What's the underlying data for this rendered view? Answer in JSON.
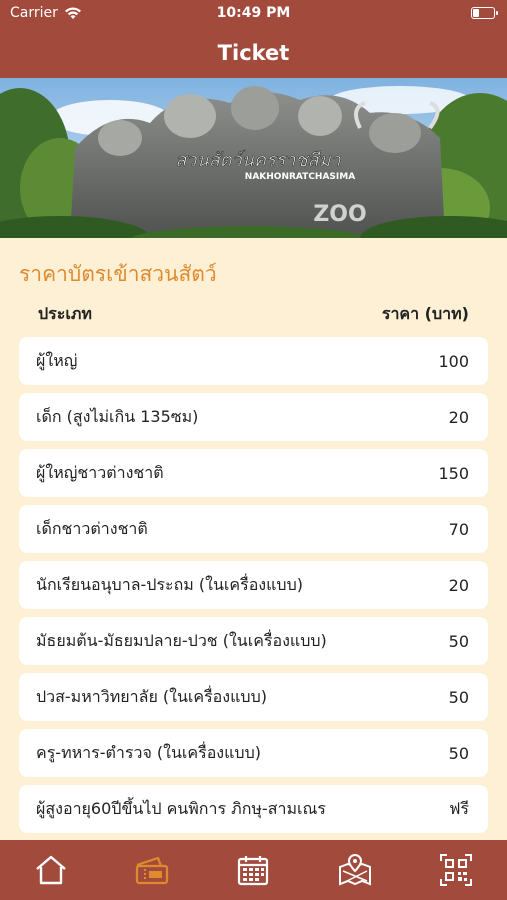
{
  "status_bar": {
    "carrier": "Carrier",
    "time": "10:49 PM",
    "battery_level": 0.3
  },
  "navbar": {
    "title": "Ticket"
  },
  "banner": {
    "sign_thai": "สวนสัตว์นครราชสีมา",
    "sign_english": "NAKHONRATCHASIMA",
    "sign_zoo": "ZOO"
  },
  "section": {
    "title": "ราคาบัตรเข้าสวนสัตว์",
    "col_type": "ประเภท",
    "col_price": "ราคา (บาท)"
  },
  "prices": [
    {
      "type": "ผู้ใหญ่",
      "price": "100"
    },
    {
      "type": "เด็ก (สูงไม่เกิน 135ซม)",
      "price": "20"
    },
    {
      "type": "ผู้ใหญ่ชาวต่างชาติ",
      "price": "150"
    },
    {
      "type": "เด็กชาวต่างชาติ",
      "price": "70"
    },
    {
      "type": "นักเรียนอนุบาล-ประถม (ในเครื่องแบบ)",
      "price": "20"
    },
    {
      "type": "มัธยมต้น-มัธยมปลาย-ปวช (ในเครื่องแบบ)",
      "price": "50"
    },
    {
      "type": "ปวส-มหาวิทยาลัย (ในเครื่องแบบ)",
      "price": "50"
    },
    {
      "type": "ครู-ทหาร-ตำรวจ (ในเครื่องแบบ)",
      "price": "50"
    },
    {
      "type": "ผู้สูงอายุ60ปีขึ้นไป คนพิการ ภิกษุ-สามเณร",
      "price": "ฟรี"
    }
  ],
  "tabbar": {
    "items": [
      {
        "icon": "home-icon",
        "active": false
      },
      {
        "icon": "ticket-icon",
        "active": true
      },
      {
        "icon": "calendar-icon",
        "active": false
      },
      {
        "icon": "map-icon",
        "active": false
      },
      {
        "icon": "qr-code-icon",
        "active": false
      }
    ]
  },
  "colors": {
    "brand": "#a24b3d",
    "accent": "#e08a2e",
    "background": "#fdf0d4"
  }
}
